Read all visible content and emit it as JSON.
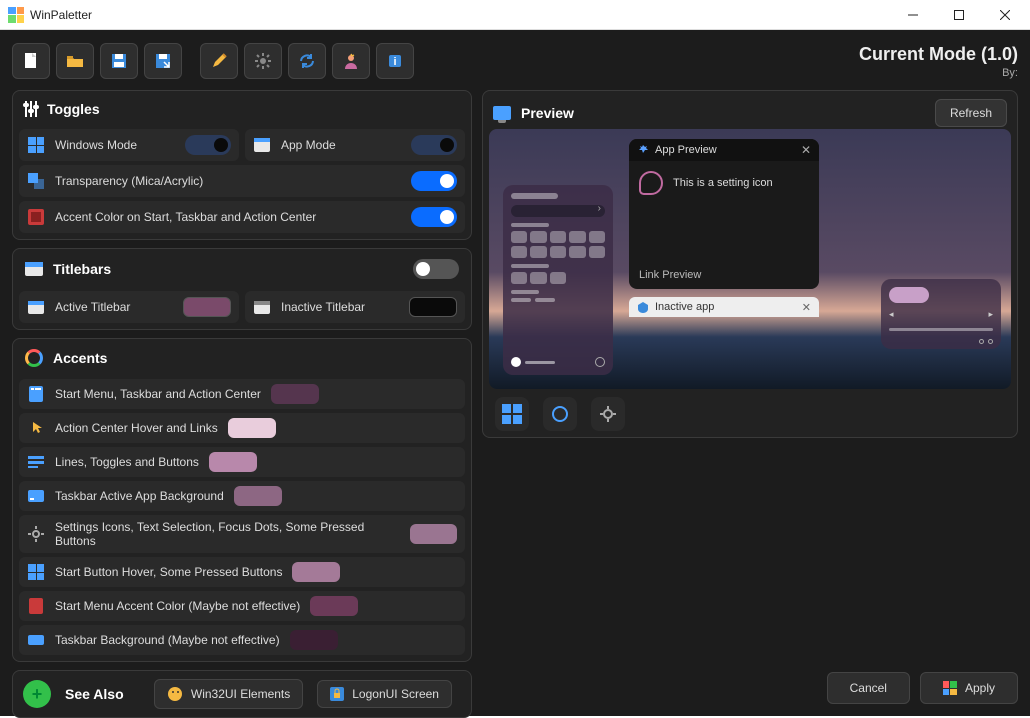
{
  "window": {
    "title": "WinPaletter"
  },
  "mode": {
    "title": "Current Mode (1.0)",
    "by": "By:"
  },
  "toolbar_icons": [
    "new-file",
    "open-folder",
    "save",
    "save-as",
    "edit",
    "settings",
    "refresh",
    "user",
    "info"
  ],
  "toggles": {
    "header": "Toggles",
    "winmode": {
      "label": "Windows Mode",
      "on": true
    },
    "appmode": {
      "label": "App Mode",
      "on": true
    },
    "transparency": {
      "label": "Transparency (Mica/Acrylic)",
      "on": true
    },
    "accent_on_start": {
      "label": "Accent Color on Start, Taskbar and Action Center",
      "on": true
    }
  },
  "titlebars": {
    "header": "Titlebars",
    "enabled": false,
    "active": {
      "label": "Active Titlebar",
      "color": "#7a4a6a"
    },
    "inactive": {
      "label": "Inactive Titlebar",
      "color": "#0a0a0a"
    }
  },
  "accents": {
    "header": "Accents",
    "items": [
      {
        "label": "Start Menu, Taskbar and Action Center",
        "color": "#55354e",
        "icon": "start-menu"
      },
      {
        "label": "Action Center Hover and Links",
        "color": "#e9cddc",
        "icon": "pointer"
      },
      {
        "label": "Lines, Toggles and Buttons",
        "color": "#b888ab",
        "icon": "lines"
      },
      {
        "label": "Taskbar Active App Background",
        "color": "#8d6783",
        "icon": "taskbar"
      },
      {
        "label": "Settings Icons, Text Selection, Focus Dots, Some Pressed Buttons",
        "color": "#9a7591",
        "icon": "gear"
      },
      {
        "label": "Start Button Hover, Some Pressed Buttons",
        "color": "#a47a98",
        "icon": "start-grid"
      },
      {
        "label": "Start Menu Accent Color (Maybe not effective)",
        "color": "#6b3a58",
        "icon": "start-red"
      },
      {
        "label": "Taskbar Background (Maybe not effective)",
        "color": "#3a1f33",
        "icon": "taskbar-bg"
      }
    ]
  },
  "seealso": {
    "header": "See Also",
    "win32": "Win32UI Elements",
    "logon": "LogonUI Screen"
  },
  "preview": {
    "header": "Preview",
    "refresh": "Refresh",
    "appwin": {
      "title": "App Preview",
      "text": "This is a setting icon",
      "link": "Link Preview"
    },
    "inactive": {
      "title": "Inactive app"
    }
  },
  "buttons": {
    "cancel": "Cancel",
    "apply": "Apply"
  }
}
